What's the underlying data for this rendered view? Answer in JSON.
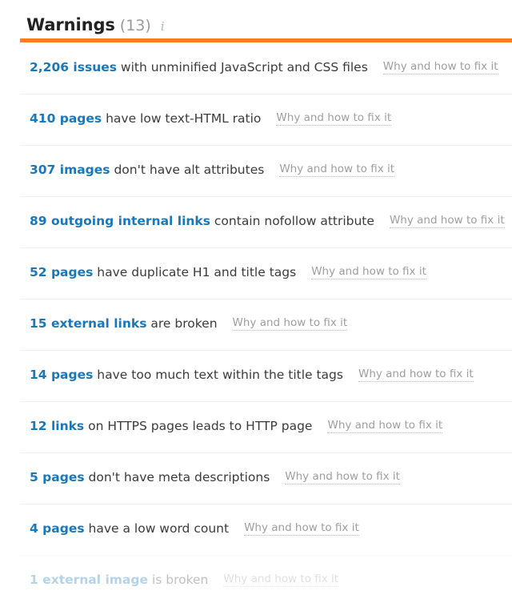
{
  "header": {
    "title": "Warnings",
    "count_label": "(13)",
    "info_icon": "info-icon",
    "info_glyph": "i",
    "accent_color": "#ff7d1a",
    "count_color": "#999999"
  },
  "common": {
    "fix_link_label": "Why and how to fix it",
    "count_color": "#1878bd",
    "text_color": "#3b3b3b",
    "link_color": "#9e9e9e"
  },
  "warnings": [
    {
      "count": "2,206 issues",
      "description": "with unminified JavaScript and CSS files",
      "fix_link": "Why and how to fix it",
      "faded": false
    },
    {
      "count": "410 pages",
      "description": "have low text-HTML ratio",
      "fix_link": "Why and how to fix it",
      "faded": false
    },
    {
      "count": "307 images",
      "description": "don't have alt attributes",
      "fix_link": "Why and how to fix it",
      "faded": false
    },
    {
      "count": "89 outgoing internal links",
      "description": "contain nofollow attribute",
      "fix_link": "Why and how to fix it",
      "faded": false
    },
    {
      "count": "52 pages",
      "description": "have duplicate H1 and title tags",
      "fix_link": "Why and how to fix it",
      "faded": false
    },
    {
      "count": "15 external links",
      "description": "are broken",
      "fix_link": "Why and how to fix it",
      "faded": false
    },
    {
      "count": "14 pages",
      "description": "have too much text within the title tags",
      "fix_link": "Why and how to fix it",
      "faded": false
    },
    {
      "count": "12 links",
      "description": "on HTTPS pages leads to HTTP page",
      "fix_link": "Why and how to fix it",
      "faded": false
    },
    {
      "count": "5 pages",
      "description": "don't have meta descriptions",
      "fix_link": "Why and how to fix it",
      "faded": false
    },
    {
      "count": "4 pages",
      "description": "have a low word count",
      "fix_link": "Why and how to fix it",
      "faded": false
    },
    {
      "count": "1 external image",
      "description": "is broken",
      "fix_link": "Why and how to fix it",
      "faded": true
    }
  ]
}
